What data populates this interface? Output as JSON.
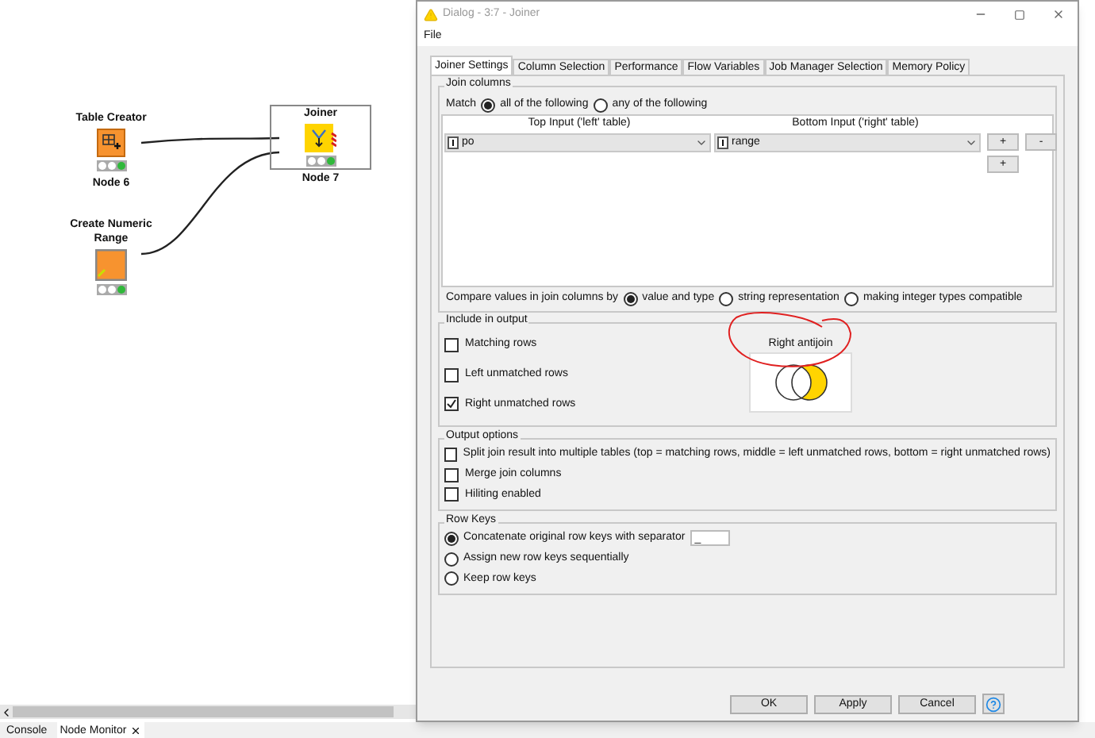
{
  "canvas": {
    "nodes": [
      {
        "kind": "table-creator",
        "title": "Table Creator",
        "label": "Node 6",
        "selected": false
      },
      {
        "kind": "numeric-range",
        "title": "Create Numeric Range",
        "selected": false
      },
      {
        "kind": "joiner",
        "title": "Joiner",
        "label": "Node 7",
        "selected": true
      }
    ]
  },
  "bottom_tabs": [
    {
      "label": "Console",
      "selected": false
    },
    {
      "label": "Node Monitor",
      "selected": true
    }
  ],
  "dialog": {
    "title": "Dialog - 3:7 - Joiner",
    "menu": [
      "File"
    ],
    "tabs": [
      {
        "label": "Joiner Settings",
        "selected": true
      },
      {
        "label": "Column Selection",
        "selected": false
      },
      {
        "label": "Performance",
        "selected": false
      },
      {
        "label": "Flow Variables",
        "selected": false
      },
      {
        "label": "Job Manager Selection",
        "selected": false
      },
      {
        "label": "Memory Policy",
        "selected": false
      }
    ],
    "join_columns": {
      "legend": "Join columns",
      "match_label": "Match",
      "match_options": [
        {
          "label": "all of the following",
          "selected": true
        },
        {
          "label": "any of the following",
          "selected": false
        }
      ],
      "columns": [
        "Top Input ('left' table)",
        "Bottom Input ('right' table)"
      ],
      "rows": [
        {
          "left": "po",
          "right": "range"
        }
      ],
      "add_label": "+",
      "remove_label": "-",
      "add_below_label": "+",
      "compare_label": "Compare values in join columns by",
      "compare_options": [
        {
          "label": "value and type",
          "selected": true
        },
        {
          "label": "string representation",
          "selected": false
        },
        {
          "label": "making integer types compatible",
          "selected": false
        }
      ]
    },
    "include": {
      "legend": "Include in output",
      "options": [
        {
          "label": "Matching rows",
          "checked": false
        },
        {
          "label": "Left unmatched rows",
          "checked": false
        },
        {
          "label": "Right unmatched rows",
          "checked": true
        }
      ],
      "join_type": "Right antijoin"
    },
    "output_options": {
      "legend": "Output options",
      "options": [
        {
          "label": "Split join result into multiple tables (top = matching rows, middle = left unmatched rows, bottom = right unmatched rows)",
          "checked": false
        },
        {
          "label": "Merge join columns",
          "checked": false
        },
        {
          "label": "Hiliting enabled",
          "checked": false
        }
      ]
    },
    "row_keys": {
      "legend": "Row Keys",
      "options": [
        {
          "label": "Concatenate original row keys with separator",
          "selected": true,
          "separator": "_"
        },
        {
          "label": "Assign new row keys sequentially",
          "selected": false
        },
        {
          "label": "Keep row keys",
          "selected": false
        }
      ]
    },
    "buttons": [
      "OK",
      "Apply",
      "Cancel"
    ]
  }
}
